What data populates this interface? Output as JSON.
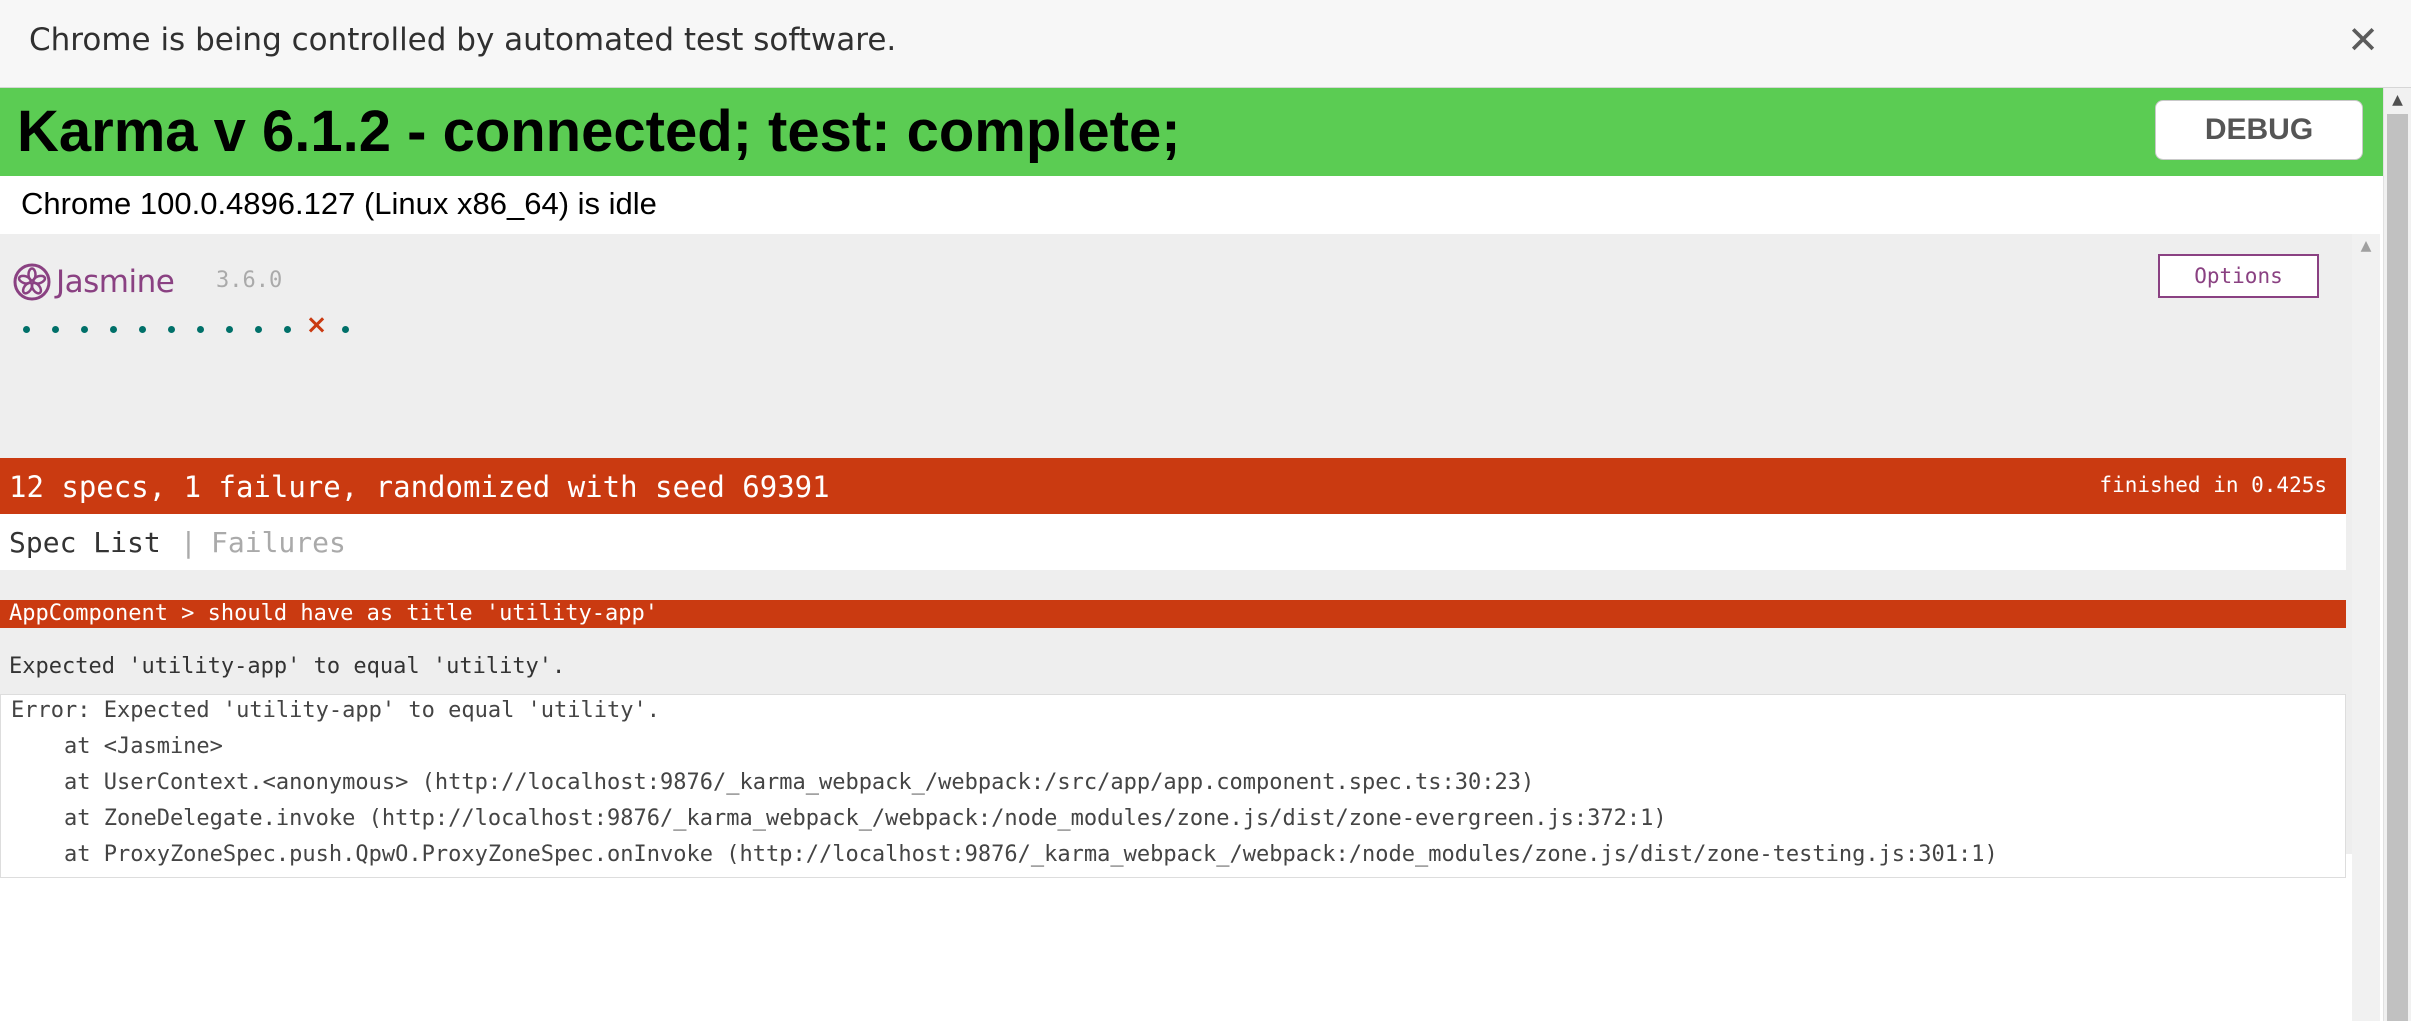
{
  "infobar": {
    "message": "Chrome is being controlled by automated test software.",
    "close_label": "✕"
  },
  "karma": {
    "title": "Karma v 6.1.2 - connected; test: complete;",
    "debug_label": "DEBUG",
    "browser_status": "Chrome 100.0.4896.127 (Linux x86_64) is idle",
    "banner_color": "#5bcc53"
  },
  "jasmine": {
    "logo_text": "Jasmine",
    "version": "3.6.0",
    "options_label": "Options",
    "spec_results": [
      "passed",
      "passed",
      "passed",
      "passed",
      "passed",
      "passed",
      "passed",
      "passed",
      "passed",
      "passed",
      "failed",
      "passed"
    ],
    "failed_symbol": "×",
    "summary": "12 specs, 1 failure, randomized with seed 69391",
    "duration": "finished in 0.425s",
    "menu": {
      "spec_list": "Spec List",
      "separator": "|",
      "failures": "Failures"
    },
    "failure": {
      "title": "AppComponent > should have as title 'utility-app'",
      "message": "Expected 'utility-app' to equal 'utility'.",
      "stack": [
        "Error: Expected 'utility-app' to equal 'utility'.",
        "    at <Jasmine>",
        "    at UserContext.<anonymous> (http://localhost:9876/_karma_webpack_/webpack:/src/app/app.component.spec.ts:30:23)",
        "    at ZoneDelegate.invoke (http://localhost:9876/_karma_webpack_/webpack:/node_modules/zone.js/dist/zone-evergreen.js:372:1)",
        "    at ProxyZoneSpec.push.QpwO.ProxyZoneSpec.onInvoke (http://localhost:9876/_karma_webpack_/webpack:/node_modules/zone.js/dist/zone-testing.js:301:1)"
      ]
    },
    "colors": {
      "failure_red": "#ca3a11",
      "brand_purple": "#8a4182",
      "pass_teal": "#007069"
    }
  },
  "icons": {
    "close": "close-icon",
    "jasmine_logo": "jasmine-flower-icon",
    "scroll_up": "scroll-up-arrow-icon"
  }
}
